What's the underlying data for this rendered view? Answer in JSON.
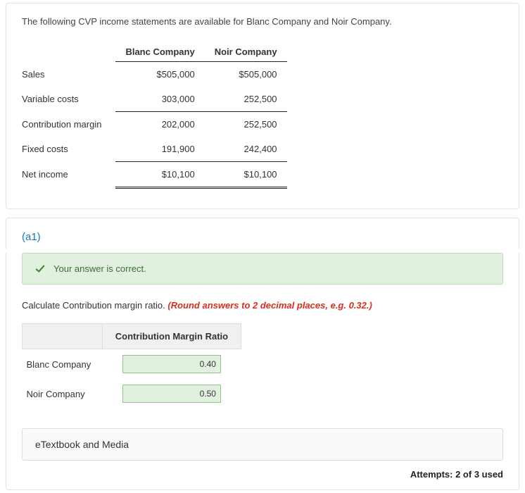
{
  "intro": "The following CVP income statements are available for Blanc Company and Noir Company.",
  "table": {
    "headers": {
      "col1": "Blanc Company",
      "col2": "Noir Company"
    },
    "rows": {
      "sales": {
        "label": "Sales",
        "c1": "$505,000",
        "c2": "$505,000"
      },
      "var": {
        "label": "Variable costs",
        "c1": "303,000",
        "c2": "252,500"
      },
      "cm": {
        "label": "Contribution margin",
        "c1": "202,000",
        "c2": "252,500"
      },
      "fixed": {
        "label": "Fixed costs",
        "c1": "191,900",
        "c2": "242,400"
      },
      "net": {
        "label": "Net income",
        "c1": "$10,100",
        "c2": "$10,100"
      }
    }
  },
  "part_label": "(a1)",
  "correct_msg": "Your answer is correct.",
  "instruction_text": "Calculate Contribution margin ratio. ",
  "instruction_hint": "(Round answers to 2 decimal places, e.g. 0.32.)",
  "ratio": {
    "header": "Contribution Margin Ratio",
    "row1": {
      "label": "Blanc Company",
      "value": "0.40"
    },
    "row2": {
      "label": "Noir Company",
      "value": "0.50"
    }
  },
  "etextbook_label": "eTextbook and Media",
  "attempts_text": "Attempts: 2 of 3 used",
  "chart_data": {
    "type": "table",
    "title": "CVP Income Statements",
    "columns": [
      "Blanc Company",
      "Noir Company"
    ],
    "rows": [
      {
        "label": "Sales",
        "values": [
          505000,
          505000
        ]
      },
      {
        "label": "Variable costs",
        "values": [
          303000,
          252500
        ]
      },
      {
        "label": "Contribution margin",
        "values": [
          202000,
          252500
        ]
      },
      {
        "label": "Fixed costs",
        "values": [
          191900,
          242400
        ]
      },
      {
        "label": "Net income",
        "values": [
          10100,
          10100
        ]
      }
    ],
    "derived": {
      "contribution_margin_ratio": {
        "Blanc Company": 0.4,
        "Noir Company": 0.5
      }
    }
  }
}
